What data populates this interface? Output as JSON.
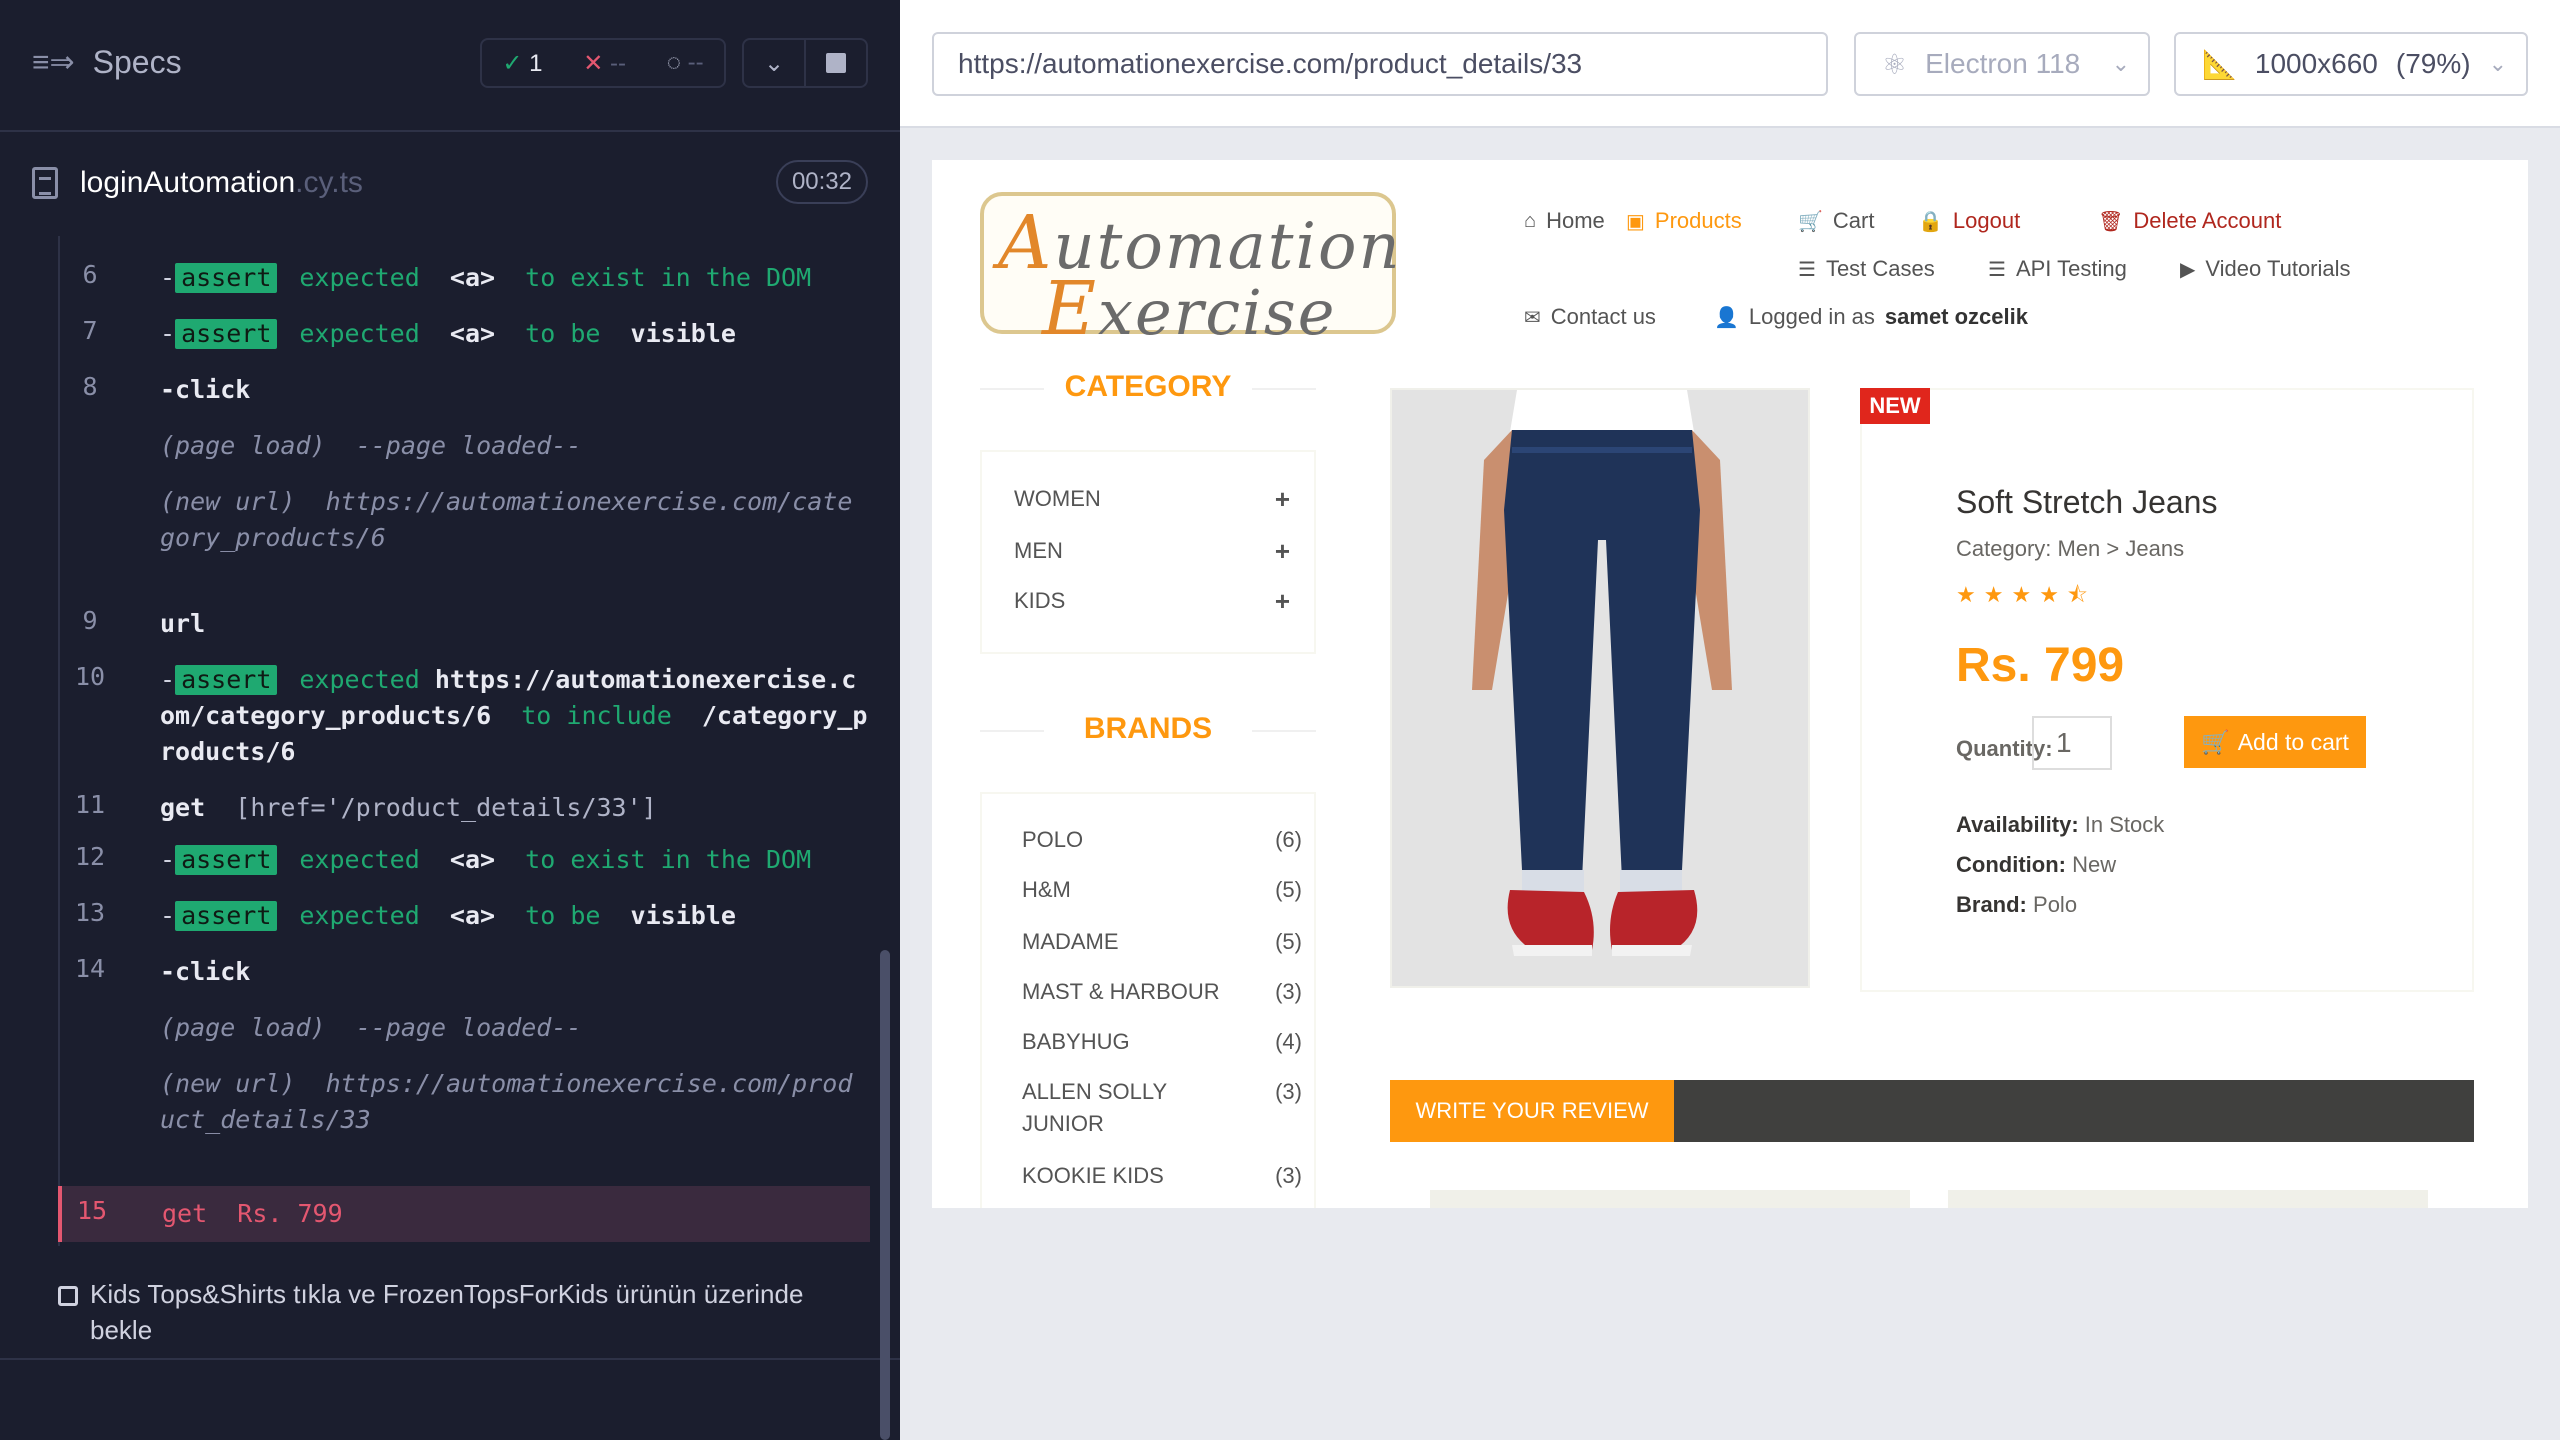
{
  "reporter": {
    "specs_label": "Specs",
    "stats": {
      "passed": "1",
      "failed": "--",
      "pending": "--"
    },
    "spec_file": {
      "name": "loginAutomation",
      "ext": ".cy.ts",
      "duration": "00:32"
    },
    "commands": [
      {
        "num": "6",
        "name": "-",
        "tag": "assert",
        "text_a": "expected",
        "text_b": "<a>",
        "text_c": "to exist in the DOM"
      },
      {
        "num": "7",
        "name": "-",
        "tag": "assert",
        "text_a": "expected",
        "text_b": "<a>",
        "text_c": "to be",
        "text_d": "visible"
      },
      {
        "num": "8",
        "name": "-click"
      },
      {
        "num": "",
        "event": "(page load)",
        "detail": "--page loaded--"
      },
      {
        "num": "",
        "event": "(new url)",
        "detail": "https://automationexercise.com/category_products/6"
      },
      {
        "num": "9",
        "name": "url"
      },
      {
        "num": "10",
        "name": "-",
        "tag": "assert",
        "text_a": "expected",
        "text_url": "https://automationexercise.com/category_products/6",
        "text_c": "to include",
        "text_d": "/category_products/6"
      },
      {
        "num": "11",
        "name": "get",
        "selector": "[href='/product_details/33']"
      },
      {
        "num": "12",
        "name": "-",
        "tag": "assert",
        "text_a": "expected",
        "text_b": "<a>",
        "text_c": "to exist in the DOM"
      },
      {
        "num": "13",
        "name": "-",
        "tag": "assert",
        "text_a": "expected",
        "text_b": "<a>",
        "text_c": "to be",
        "text_d": "visible"
      },
      {
        "num": "14",
        "name": "-click"
      },
      {
        "num": "",
        "event": "(page load)",
        "detail": "--page loaded--"
      },
      {
        "num": "",
        "event": "(new url)",
        "detail": "https://automationexercise.com/product_details/33"
      },
      {
        "num": "15",
        "name": "get",
        "selector": "Rs. 799"
      }
    ],
    "next_test": "Kids Tops&Shirts tıkla ve FrozenTopsForKids ürünün üzerinde bekle"
  },
  "aut": {
    "url": "https://automationexercise.com/product_details/33",
    "browser": "Electron 118",
    "viewport": "1000x660",
    "zoom": "(79%)",
    "site": {
      "logo_line1_cap": "A",
      "logo_line1_rest": "utomation",
      "logo_line2_cap": "E",
      "logo_line2_rest": "xercise",
      "nav": {
        "home": "Home",
        "products": "Products",
        "cart": "Cart",
        "logout": "Logout",
        "delete": "Delete Account",
        "test_cases": "Test Cases",
        "api_testing": "API Testing",
        "video": "Video Tutorials",
        "contact": "Contact us",
        "logged_prefix": "Logged in as",
        "logged_user": "samet ozcelik"
      },
      "category_title": "CATEGORY",
      "categories": [
        "WOMEN",
        "MEN",
        "KIDS"
      ],
      "brands_title": "BRANDS",
      "brands": [
        {
          "name": "POLO",
          "count": "(6)"
        },
        {
          "name": "H&M",
          "count": "(5)"
        },
        {
          "name": "MADAME",
          "count": "(5)"
        },
        {
          "name": "MAST & HARBOUR",
          "count": "(3)"
        },
        {
          "name": "BABYHUG",
          "count": "(4)"
        },
        {
          "name": "ALLEN SOLLY JUNIOR",
          "count": "(3)"
        },
        {
          "name": "KOOKIE KIDS",
          "count": "(3)"
        }
      ],
      "product": {
        "badge": "NEW",
        "name": "Soft Stretch Jeans",
        "category": "Category: Men > Jeans",
        "rating": 4.5,
        "price": "Rs. 799",
        "quantity_label": "Quantity:",
        "quantity": "1",
        "add_to_cart": "Add to cart",
        "availability_label": "Availability:",
        "availability": "In Stock",
        "condition_label": "Condition:",
        "condition": "New",
        "brand_label": "Brand:",
        "brand": "Polo"
      },
      "review_tab": "WRITE YOUR REVIEW"
    }
  }
}
